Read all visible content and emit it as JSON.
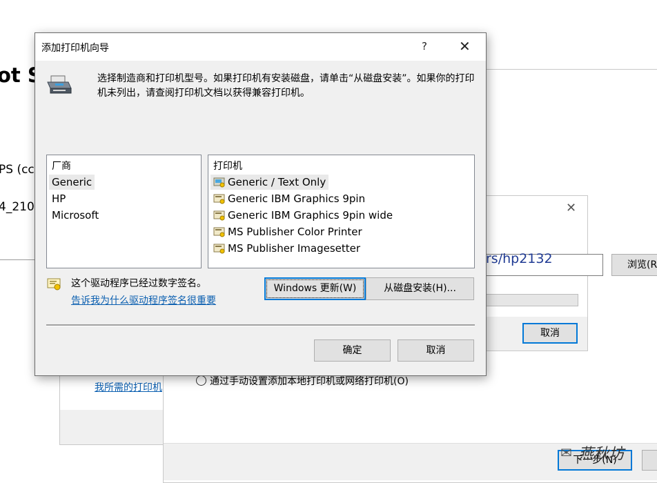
{
  "background": {
    "partial_title": "ot S",
    "partial_line_1": "PS (cc",
    "partial_line_2": "4_210",
    "link_partial": "我所需的打印机",
    "radio_option_label": "通过手动设置添加本地打印机或网络打印机(O)",
    "next_button_label": "下一步(N)",
    "path_partial": "rs/hp2132",
    "browse_button_label": "浏览(R",
    "cancel_button_label": "取消",
    "watermark": "燕秋坊"
  },
  "dialog": {
    "title": "添加打印机向导",
    "help_label": "?",
    "close_label": "✕",
    "instructions": "选择制造商和打印机型号。如果打印机有安装磁盘，请单击“从磁盘安装”。如果你的打印机未列出，请查阅打印机文档以获得兼容打印机。",
    "manufacturer_header": "厂商",
    "manufacturers": [
      "Generic",
      "HP",
      "Microsoft"
    ],
    "selected_manufacturer": "Generic",
    "printer_header": "打印机",
    "printers": [
      "Generic / Text Only",
      "Generic IBM Graphics 9pin",
      "Generic IBM Graphics 9pin wide",
      "MS Publisher Color Printer",
      "MS Publisher Imagesetter"
    ],
    "selected_printer": "Generic / Text Only",
    "signed_text": "这个驱动程序已经过数字签名。",
    "signed_link": "告诉我为什么驱动程序签名很重要",
    "windows_update_button": "Windows 更新(W)",
    "have_disk_button": "从磁盘安装(H)...",
    "ok_button": "确定",
    "cancel_button": "取消"
  },
  "icons": {
    "printer": "printer-icon",
    "certificate": "certificate-icon",
    "driver": "driver-printer-icon"
  },
  "colors": {
    "accent": "#0078d7",
    "link": "#0b5fb0",
    "dialog_bg": "#f0f0f0"
  }
}
